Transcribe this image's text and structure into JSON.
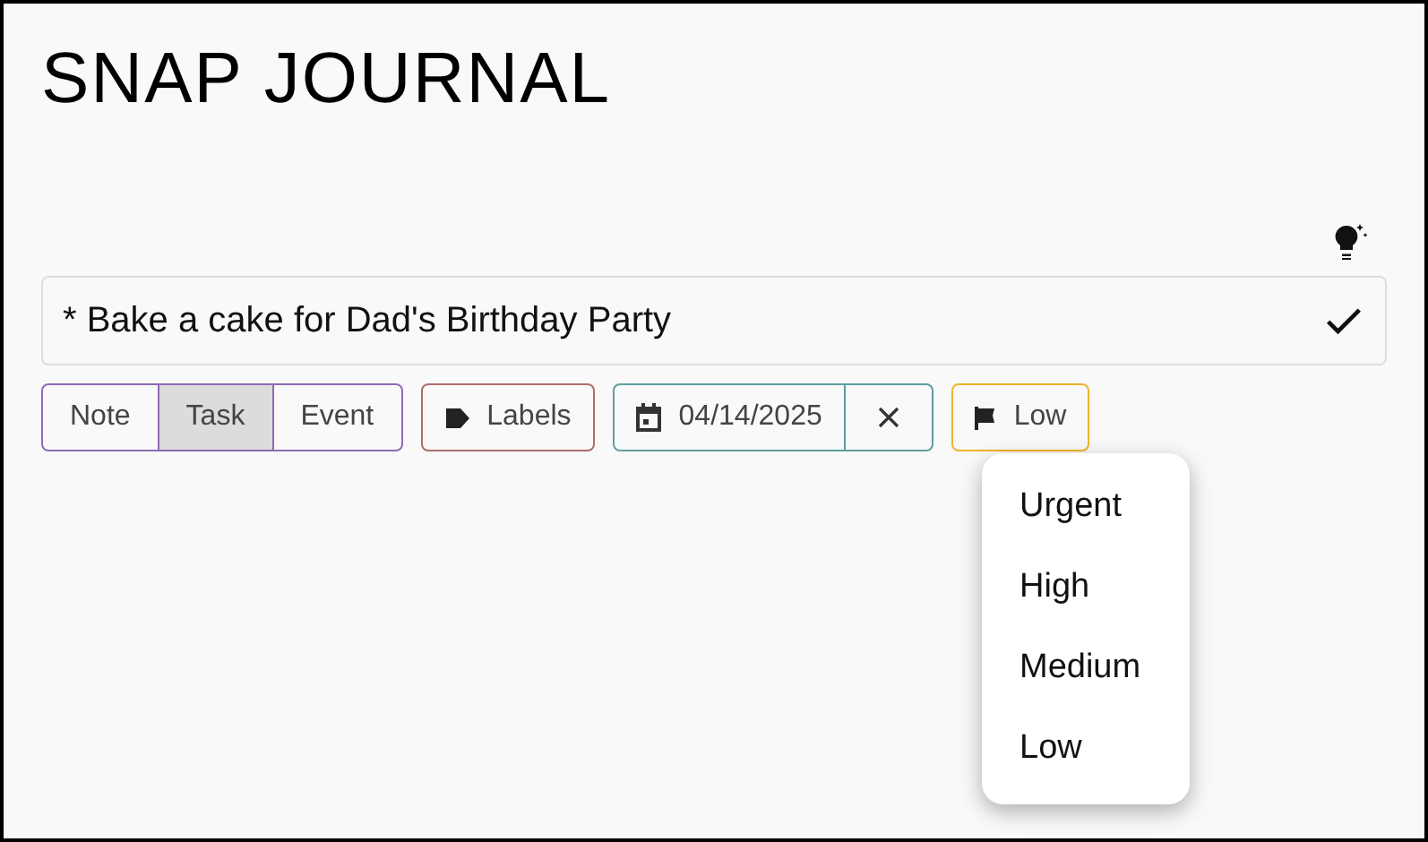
{
  "app_title": "SNAP JOURNAL",
  "entry": {
    "value": "* Bake a cake for Dad's Birthday Party"
  },
  "entry_types": [
    {
      "label": "Note",
      "selected": false
    },
    {
      "label": "Task",
      "selected": true
    },
    {
      "label": "Event",
      "selected": false
    }
  ],
  "labels_button": {
    "label": "Labels"
  },
  "date_field": {
    "value": "04/14/2025"
  },
  "priority_button": {
    "label": "Low",
    "expanded": true
  },
  "priority_menu": [
    {
      "label": "Urgent"
    },
    {
      "label": "High"
    },
    {
      "label": "Medium"
    },
    {
      "label": "Low"
    }
  ]
}
